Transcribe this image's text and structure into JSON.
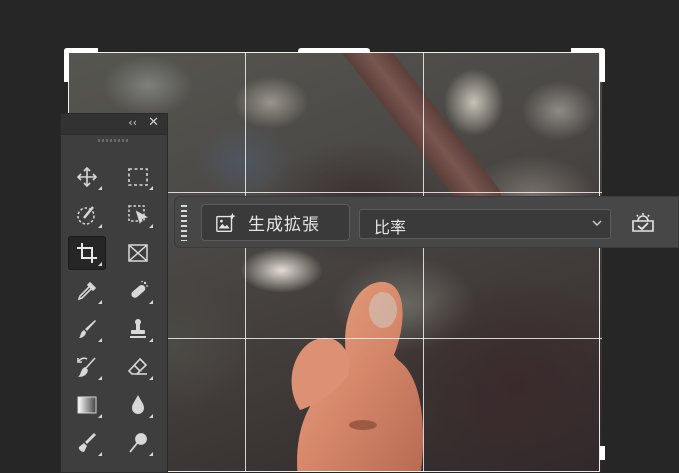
{
  "tools_panel": {
    "collapse_glyph": "‹‹",
    "close_glyph": "✕",
    "tools": [
      {
        "id": "move",
        "icon": "move-icon"
      },
      {
        "id": "marquee",
        "icon": "rectangular-marquee-icon"
      },
      {
        "id": "quick-selection",
        "icon": "quick-selection-icon"
      },
      {
        "id": "object-selection",
        "icon": "object-selection-icon"
      },
      {
        "id": "crop",
        "icon": "crop-icon",
        "active": true
      },
      {
        "id": "frame",
        "icon": "frame-icon"
      },
      {
        "id": "eyedropper",
        "icon": "eyedropper-icon"
      },
      {
        "id": "spot-healing",
        "icon": "spot-healing-brush-icon"
      },
      {
        "id": "brush",
        "icon": "brush-icon"
      },
      {
        "id": "clone-stamp",
        "icon": "clone-stamp-icon"
      },
      {
        "id": "history-brush",
        "icon": "history-brush-icon"
      },
      {
        "id": "eraser",
        "icon": "eraser-icon"
      },
      {
        "id": "gradient",
        "icon": "gradient-icon"
      },
      {
        "id": "blur",
        "icon": "blur-icon"
      },
      {
        "id": "smudge",
        "icon": "smudge-icon"
      },
      {
        "id": "dodge",
        "icon": "dodge-icon"
      }
    ]
  },
  "taskbar": {
    "generative_expand_label": "生成拡張",
    "ratio_value": "比率"
  },
  "colors": {
    "panel_bg": "#3e3e3e",
    "app_bg": "#262626",
    "taskbar_bg": "#474747"
  }
}
